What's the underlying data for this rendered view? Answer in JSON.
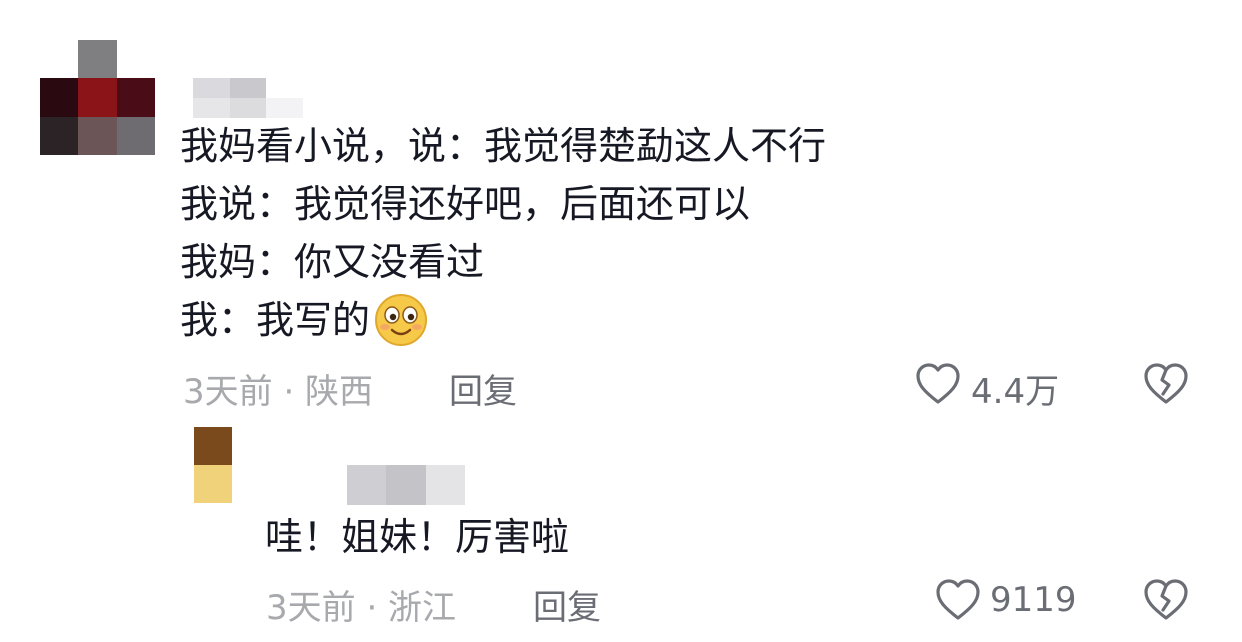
{
  "comments": [
    {
      "lines": [
        "我妈看小说，说：我觉得楚勐这人不行",
        "我说：我觉得还好吧，后面还可以",
        "我妈：你又没看过",
        "我：我写的"
      ],
      "emoji": "smiling-face-emoji",
      "meta": "3天前 · 陕西",
      "reply_label": "回复",
      "likes": "4.4万"
    },
    {
      "text": "哇！姐妹！厉害啦",
      "meta": "3天前 · 浙江",
      "reply_label": "回复",
      "likes": "9119"
    }
  ],
  "icons": {
    "like": "heart-outline-icon",
    "dislike": "broken-heart-icon"
  },
  "colors": {
    "text": "#161823",
    "meta": "#a8a9ad",
    "action": "#6b6d75",
    "emoji_face": "#f7c948"
  }
}
